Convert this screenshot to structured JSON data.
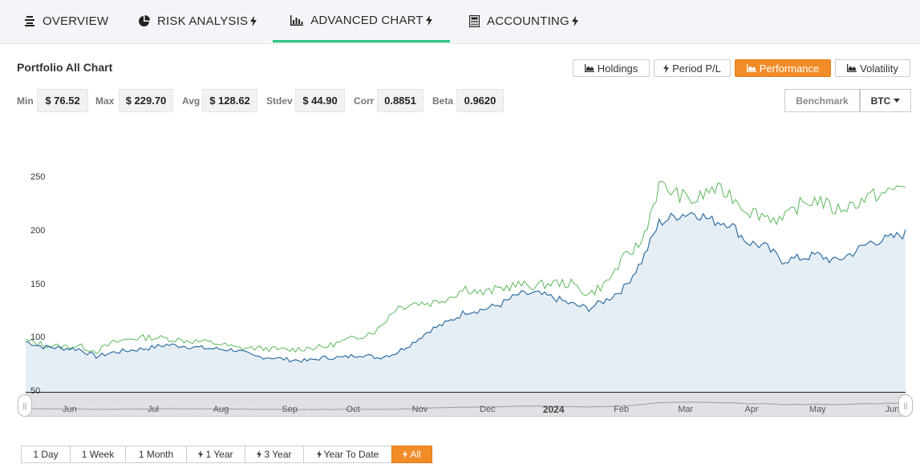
{
  "tabs": [
    {
      "label": "OVERVIEW",
      "icon": "list-icon",
      "bolt": false,
      "active": false
    },
    {
      "label": "RISK ANALYSIS",
      "icon": "pie-chart-icon",
      "bolt": true,
      "active": false
    },
    {
      "label": "ADVANCED CHART",
      "icon": "bar-chart-icon",
      "bolt": true,
      "active": true
    },
    {
      "label": "ACCOUNTING",
      "icon": "calculator-icon",
      "bolt": true,
      "active": false
    }
  ],
  "chart_title": "Portfolio All Chart",
  "modes": [
    {
      "label": "Holdings",
      "icon": "area-chart-icon",
      "active": false
    },
    {
      "label": "Period P/L",
      "icon": "bolt-icon",
      "active": false
    },
    {
      "label": "Performance",
      "icon": "area-chart-icon",
      "active": true
    },
    {
      "label": "Volatility",
      "icon": "area-chart-icon",
      "active": false
    }
  ],
  "stats": [
    {
      "label": "Min",
      "value": "$ 76.52"
    },
    {
      "label": "Max",
      "value": "$ 229.70"
    },
    {
      "label": "Avg",
      "value": "$ 128.62"
    },
    {
      "label": "Stdev",
      "value": "$ 44.90"
    },
    {
      "label": "Corr",
      "value": "0.8851"
    },
    {
      "label": "Beta",
      "value": "0.9620"
    }
  ],
  "benchmark_label": "Benchmark",
  "benchmark_value": "BTC",
  "colors": {
    "accent": "#f28c28",
    "tab_active": "#2ec27e",
    "series_portfolio": "#2f6fa5",
    "series_benchmark": "#5cb85c",
    "area_fill": "#e6eef5"
  },
  "ranges": [
    {
      "label": "1 Day",
      "bolt": false,
      "active": false
    },
    {
      "label": "1 Week",
      "bolt": false,
      "active": false
    },
    {
      "label": "1 Month",
      "bolt": false,
      "active": false
    },
    {
      "label": "1 Year",
      "bolt": true,
      "active": false
    },
    {
      "label": "3 Year",
      "bolt": true,
      "active": false
    },
    {
      "label": "Year To Date",
      "bolt": true,
      "active": false
    },
    {
      "label": "All",
      "bolt": true,
      "active": true
    }
  ],
  "chart_data": {
    "type": "line",
    "y_ticks": [
      250,
      200,
      150,
      100,
      50
    ],
    "ylim": [
      50,
      270
    ],
    "x_ticks": [
      {
        "label": "Jun",
        "pos": 0.05
      },
      {
        "label": "Jul",
        "pos": 0.145
      },
      {
        "label": "Aug",
        "pos": 0.222
      },
      {
        "label": "Sep",
        "pos": 0.3
      },
      {
        "label": "Oct",
        "pos": 0.372
      },
      {
        "label": "Nov",
        "pos": 0.448
      },
      {
        "label": "Dec",
        "pos": 0.525
      },
      {
        "label": "2024",
        "pos": 0.6,
        "bold": true
      },
      {
        "label": "Feb",
        "pos": 0.677
      },
      {
        "label": "Mar",
        "pos": 0.75
      },
      {
        "label": "Apr",
        "pos": 0.825
      },
      {
        "label": "May",
        "pos": 0.9
      },
      {
        "label": "Jun",
        "pos": 0.985
      }
    ],
    "x": [
      0.0,
      0.02,
      0.04,
      0.06,
      0.08,
      0.1,
      0.12,
      0.14,
      0.16,
      0.18,
      0.2,
      0.22,
      0.24,
      0.26,
      0.28,
      0.3,
      0.32,
      0.34,
      0.36,
      0.38,
      0.4,
      0.42,
      0.44,
      0.46,
      0.48,
      0.5,
      0.52,
      0.54,
      0.56,
      0.58,
      0.6,
      0.62,
      0.64,
      0.66,
      0.68,
      0.7,
      0.72,
      0.74,
      0.76,
      0.78,
      0.8,
      0.82,
      0.84,
      0.86,
      0.88,
      0.9,
      0.92,
      0.94,
      0.96,
      0.98,
      1.0
    ],
    "series": [
      {
        "name": "Portfolio",
        "values": [
          97,
          92,
          91,
          90,
          83,
          87,
          89,
          91,
          94,
          93,
          91,
          90,
          89,
          83,
          82,
          80,
          79,
          82,
          82,
          85,
          82,
          86,
          96,
          108,
          115,
          125,
          127,
          132,
          141,
          142,
          138,
          132,
          128,
          136,
          147,
          172,
          208,
          215,
          218,
          210,
          208,
          190,
          186,
          173,
          175,
          178,
          172,
          180,
          190,
          193,
          198
        ]
      },
      {
        "name": "BTC",
        "values": [
          98,
          94,
          92,
          93,
          88,
          96,
          100,
          101,
          100,
          98,
          97,
          95,
          91,
          91,
          90,
          89,
          91,
          92,
          97,
          102,
          108,
          128,
          133,
          133,
          138,
          147,
          142,
          147,
          150,
          149,
          152,
          151,
          141,
          152,
          175,
          190,
          243,
          235,
          228,
          240,
          235,
          220,
          215,
          210,
          225,
          230,
          220,
          225,
          233,
          236,
          245
        ]
      }
    ],
    "navigator": true
  }
}
